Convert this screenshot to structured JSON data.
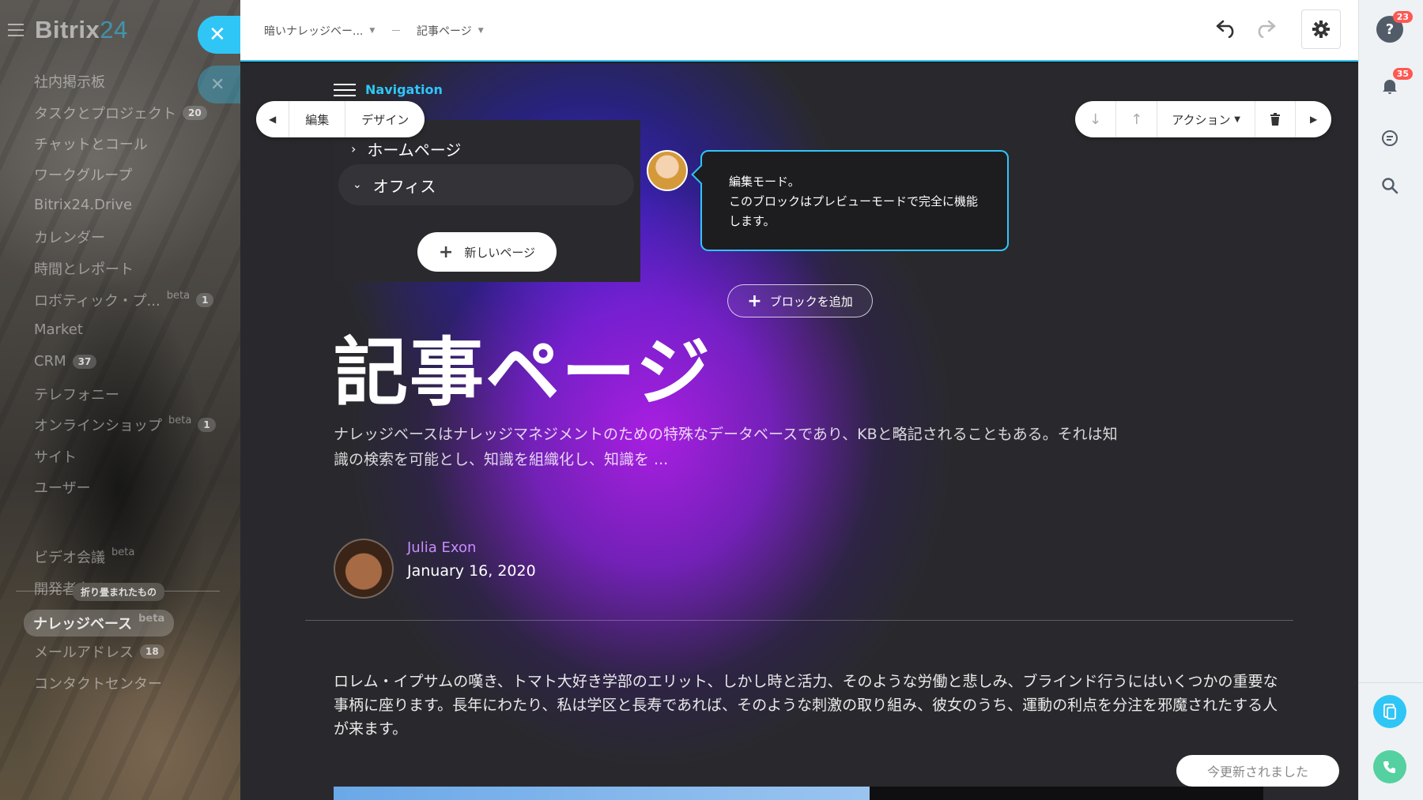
{
  "app": {
    "logo_name": "Bitrix",
    "logo_num": "24"
  },
  "sidebar": {
    "items": [
      {
        "label": "社内掲示板",
        "badge": ""
      },
      {
        "label": "タスクとプロジェクト",
        "badge": "20"
      },
      {
        "label": "チャットとコール",
        "badge": ""
      },
      {
        "label": "ワークグループ",
        "badge": ""
      },
      {
        "label": "Bitrix24.Drive",
        "badge": ""
      },
      {
        "label": "カレンダー",
        "badge": ""
      },
      {
        "label": "時間とレポート",
        "badge": ""
      },
      {
        "label": "ロボティック・プ...",
        "beta": "beta",
        "badge": "1"
      },
      {
        "label": "Market",
        "badge": ""
      },
      {
        "label": "CRM",
        "badge": "37"
      },
      {
        "label": "テレフォニー",
        "badge": ""
      },
      {
        "label": "オンラインショップ",
        "beta": "beta",
        "badge": "1"
      },
      {
        "label": "サイト",
        "badge": ""
      },
      {
        "label": "ユーザー",
        "badge": ""
      }
    ],
    "collapsed_label": "折り畳まれたもの",
    "collapsed_items": [
      {
        "label": "ビデオ会議",
        "beta": "beta"
      },
      {
        "label": "開発者向けリソース"
      },
      {
        "label": "ナレッジベース",
        "beta": "beta",
        "active": true
      },
      {
        "label": "メールアドレス",
        "badge": "18"
      },
      {
        "label": "コンタクトセンター"
      }
    ]
  },
  "topbar": {
    "breadcrumb_site": "暗いナレッジベー...",
    "breadcrumb_page": "記事ページ"
  },
  "editor": {
    "nav_label": "Navigation",
    "nav_items": [
      "ホームページ",
      "オフィス"
    ],
    "new_page_label": "新しいページ",
    "toolbar_left": {
      "edit": "編集",
      "design": "デザイン"
    },
    "toolbar_right": {
      "actions": "アクション"
    },
    "tooltip_line1": "編集モード。",
    "tooltip_line2": "このブロックはプレビューモードで完全に機能します。",
    "add_block_label": "ブロックを追加",
    "updated_label": "今更新されました"
  },
  "article": {
    "title": "記事ページ",
    "lead": "ナレッジベースはナレッジマネジメントのための特殊なデータベースであり、KBと略記されることもある。それは知識の検索を可能とし、知識を組織化し、知識を ...",
    "author_name": "Julia Exon",
    "date": "January 16, 2020",
    "body": "ロレム・イプサムの嘆き、トマト大好き学部のエリット、しかし時と活力、そのような労働と悲しみ、ブラインド行うにはいくつかの重要な事柄に座ります。長年にわたり、私は学区と長寿であれば、そのような刺激の取り組み、彼女のうち、運動の利点を分注を邪魔されたする人が来ます。"
  },
  "rightbar": {
    "help_badge": "23",
    "notif_badge": "35"
  },
  "colors": {
    "accent": "#2fc6f6",
    "author_name": "#c98cff",
    "badge_red": "#ff5752",
    "call_green": "#55d0a0"
  }
}
